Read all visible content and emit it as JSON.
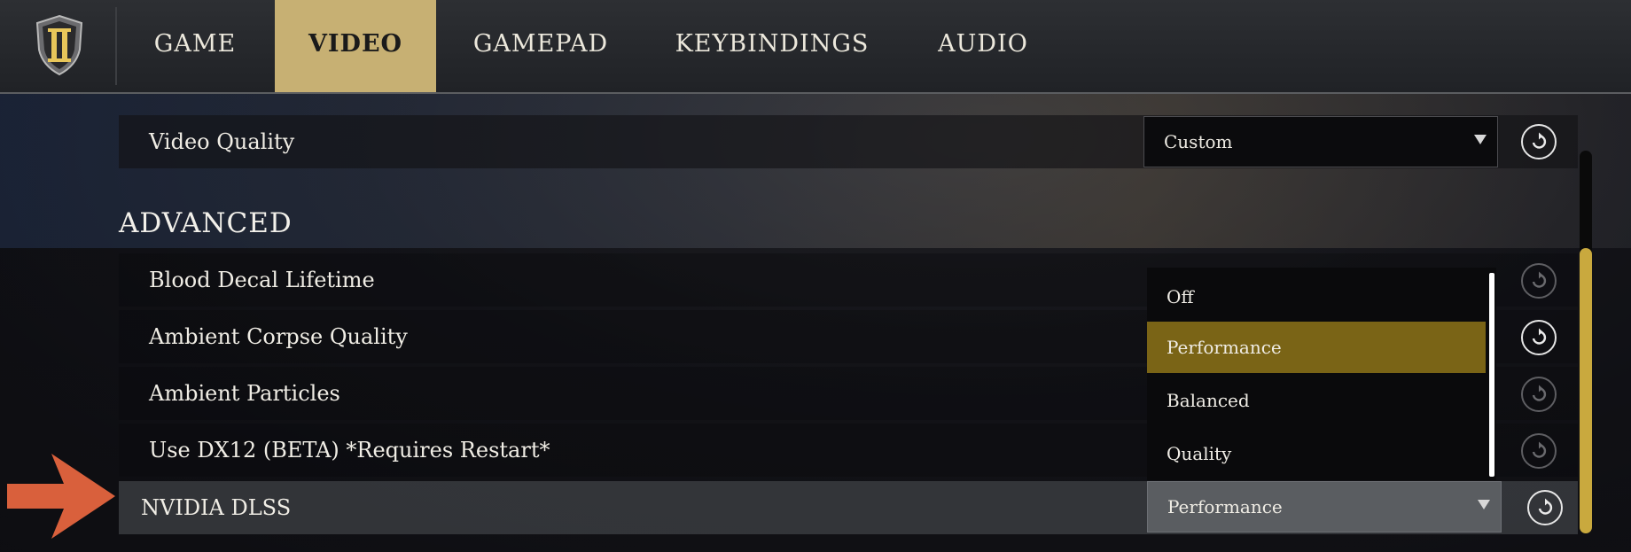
{
  "nav": {
    "tabs": [
      {
        "label": "GAME"
      },
      {
        "label": "VIDEO"
      },
      {
        "label": "GAMEPAD"
      },
      {
        "label": "KEYBINDINGS"
      },
      {
        "label": "AUDIO"
      }
    ],
    "active_tab": "VIDEO"
  },
  "video_quality": {
    "label": "Video Quality",
    "value": "Custom"
  },
  "advanced": {
    "title": "ADVANCED",
    "rows": [
      {
        "label": "Blood Decal Lifetime"
      },
      {
        "label": "Ambient Corpse Quality"
      },
      {
        "label": "Ambient Particles"
      },
      {
        "label": "Use DX12 (BETA) *Requires Restart*"
      },
      {
        "label": "NVIDIA DLSS",
        "value": "Performance"
      }
    ]
  },
  "dlss_dropdown": {
    "options": [
      "Off",
      "Performance",
      "Balanced",
      "Quality"
    ],
    "highlighted": "Performance"
  },
  "colors": {
    "accent_gold": "#c7b073",
    "highlight": "#7a6416",
    "scroll_thumb": "#c9a93e",
    "pointer_arrow": "#d9603c"
  },
  "scroll": {
    "position_fraction": 0.25
  }
}
